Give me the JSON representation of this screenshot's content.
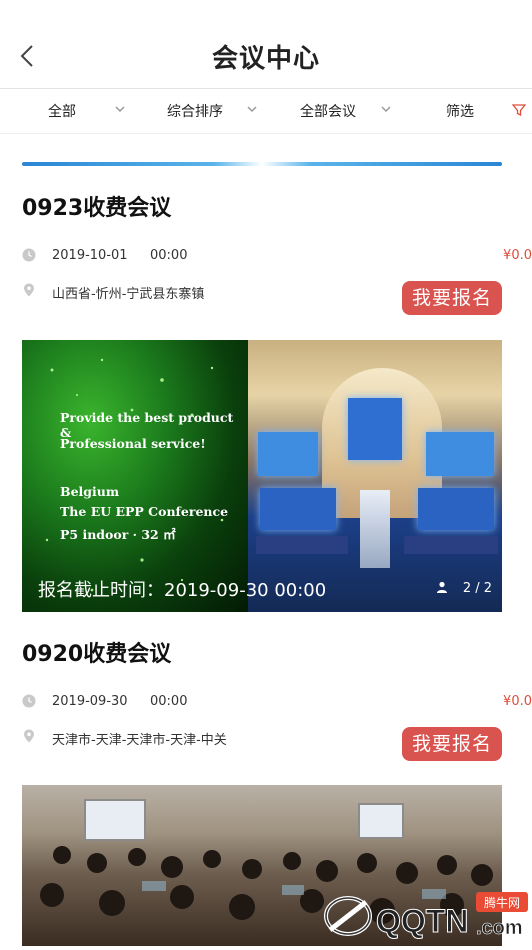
{
  "header": {
    "title": "会议中心"
  },
  "filters": [
    {
      "label": "全部"
    },
    {
      "label": "综合排序"
    },
    {
      "label": "全部会议"
    },
    {
      "label": "筛选"
    }
  ],
  "colors": {
    "accent": "#d9534f",
    "price": "#e14c3a",
    "divider": "#2a86d4"
  },
  "meetings": [
    {
      "title": "0923收费会议",
      "date": "2019-10-01",
      "time": "00:00",
      "price": "¥0.0",
      "location": "山西省-忻州-宁武县东寨镇",
      "signup_label": "我要报名",
      "banner_lines": [
        "Provide the best product &",
        "Professional service!",
        "Belgium",
        "The EU EPP Conference",
        "P5 indoor · 32 ㎡"
      ],
      "deadline": "报名截止时间：2019-09-30 00:00",
      "pager": "2 / 2"
    },
    {
      "title": "0920收费会议",
      "date": "2019-09-30",
      "time": "00:00",
      "price": "¥0.0",
      "location": "天津市-天津-天津市-天津-中关",
      "signup_label": "我要报名"
    }
  ],
  "watermark": {
    "brand": "QQTN",
    "suffix": ".com",
    "tag": "腾牛网"
  }
}
